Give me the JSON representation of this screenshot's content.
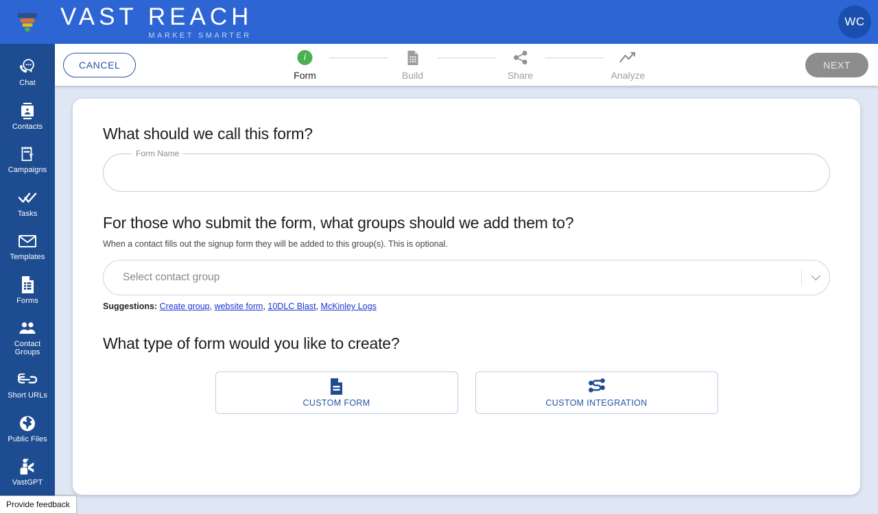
{
  "header": {
    "brand_title": "VAST REACH",
    "brand_tagline": "MARKET SMARTER",
    "logo_icon": "funnel-icon",
    "avatar_initials": "WC",
    "brand_blue": "#2d66d4"
  },
  "sidebar": {
    "bg": "#1e4c91",
    "items": [
      {
        "label": "Chat",
        "icon": "chat-phone-icon"
      },
      {
        "label": "Contacts",
        "icon": "contact-card-icon"
      },
      {
        "label": "Campaigns",
        "icon": "campaign-calendar-icon"
      },
      {
        "label": "Tasks",
        "icon": "double-check-icon"
      },
      {
        "label": "Templates",
        "icon": "envelope-icon"
      },
      {
        "label": "Forms",
        "icon": "form-document-icon"
      },
      {
        "label": "Contact Groups",
        "icon": "people-group-icon"
      },
      {
        "label": "Short URLs",
        "icon": "link-chain-icon"
      },
      {
        "label": "Public Files",
        "icon": "globe-icon"
      },
      {
        "label": "VastGPT",
        "icon": "robot-hand-icon"
      }
    ]
  },
  "toolbar": {
    "cancel_label": "CANCEL",
    "next_label": "NEXT",
    "next_disabled": true,
    "steps": [
      {
        "label": "Form",
        "icon": "info-circle-icon",
        "state": "active"
      },
      {
        "label": "Build",
        "icon": "document-grid-icon",
        "state": "inactive"
      },
      {
        "label": "Share",
        "icon": "share-nodes-icon",
        "state": "inactive"
      },
      {
        "label": "Analyze",
        "icon": "trend-line-icon",
        "state": "inactive"
      }
    ],
    "active_step_color": "#4caf50"
  },
  "main": {
    "question_name": "What should we call this form?",
    "form_name_label": "Form Name",
    "form_name_value": "",
    "form_name_placeholder": "",
    "question_groups": "For those who submit the form, what groups should we add them to?",
    "groups_help": "When a contact fills out the signup form they will be added to this group(s). This is optional.",
    "group_select_placeholder": "Select contact group",
    "group_select_value": "",
    "suggestions_label": "Suggestions:",
    "suggestions": [
      "Create group",
      "website form",
      "10DLC Blast",
      "McKinley Logs"
    ],
    "suggestion_separator": ", ",
    "question_type": "What type of form would you like to create?",
    "choices": [
      {
        "label": "CUSTOM FORM",
        "icon": "document-lines-icon"
      },
      {
        "label": "CUSTOM INTEGRATION",
        "icon": "integration-nodes-icon"
      }
    ]
  },
  "footer": {
    "feedback_label": "Provide feedback"
  }
}
